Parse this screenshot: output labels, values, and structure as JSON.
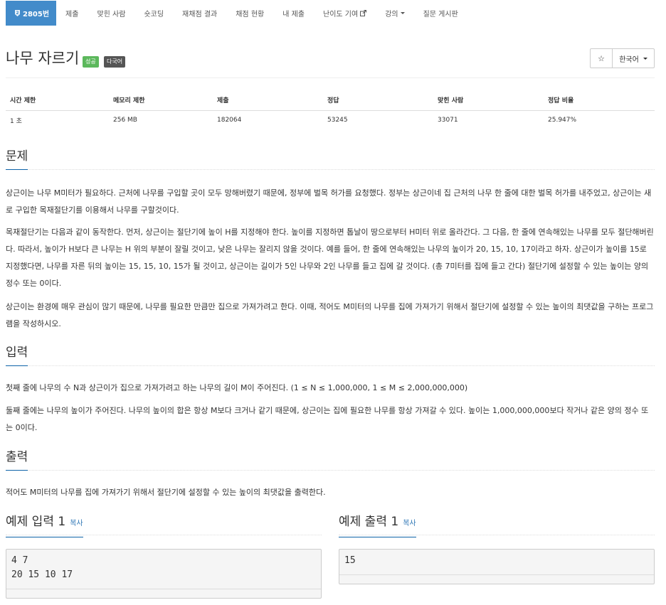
{
  "nav": {
    "tabs": [
      {
        "label": "2805번"
      },
      {
        "label": "제출"
      },
      {
        "label": "맞힌 사람"
      },
      {
        "label": "숏코딩"
      },
      {
        "label": "재채점 결과"
      },
      {
        "label": "채점 현황"
      },
      {
        "label": "내 제출"
      },
      {
        "label": "난이도 기여"
      },
      {
        "label": "강의"
      },
      {
        "label": "질문 게시판"
      }
    ]
  },
  "problem": {
    "title": "나무 자르기",
    "badges": {
      "success": "성공",
      "lang": "다국어"
    },
    "star_icon": "☆",
    "language": "한국어",
    "colors": {
      "primary": "#428bca",
      "success": "#5cb85c",
      "badge_dark": "#555555",
      "link": "#337ab7"
    }
  },
  "info": {
    "headers": [
      "시간 제한",
      "메모리 제한",
      "제출",
      "정답",
      "맞힌 사람",
      "정답 비율"
    ],
    "values": [
      "1 초",
      "256 MB",
      "182064",
      "53245",
      "33071",
      "25.947%"
    ]
  },
  "sections": {
    "description": {
      "heading": "문제",
      "paragraphs": [
        "상근이는 나무 M미터가 필요하다. 근처에 나무를 구입할 곳이 모두 망해버렸기 때문에, 정부에 벌목 허가를 요청했다. 정부는 상근이네 집 근처의 나무 한 줄에 대한 벌목 허가를 내주었고, 상근이는 새로 구입한 목재절단기를 이용해서 나무를 구할것이다.",
        "목재절단기는 다음과 같이 동작한다. 먼저, 상근이는 절단기에 높이 H를 지정해야 한다. 높이를 지정하면 톱날이 땅으로부터 H미터 위로 올라간다. 그 다음, 한 줄에 연속해있는 나무를 모두 절단해버린다. 따라서, 높이가 H보다 큰 나무는 H 위의 부분이 잘릴 것이고, 낮은 나무는 잘리지 않을 것이다. 예를 들어, 한 줄에 연속해있는 나무의 높이가 20, 15, 10, 17이라고 하자. 상근이가 높이를 15로 지정했다면, 나무를 자른 뒤의 높이는 15, 15, 10, 15가 될 것이고, 상근이는 길이가 5인 나무와 2인 나무를 들고 집에 갈 것이다. (총 7미터를 집에 들고 간다) 절단기에 설정할 수 있는 높이는 양의 정수 또는 0이다.",
        "상근이는 환경에 매우 관심이 많기 때문에, 나무를 필요한 만큼만 집으로 가져가려고 한다. 이때, 적어도 M미터의 나무를 집에 가져가기 위해서 절단기에 설정할 수 있는 높이의 최댓값을 구하는 프로그램을 작성하시오."
      ]
    },
    "input": {
      "heading": "입력",
      "paragraphs": [
        "첫째 줄에 나무의 수 N과 상근이가 집으로 가져가려고 하는 나무의 길이 M이 주어진다. (1 ≤ N ≤ 1,000,000, 1 ≤ M ≤ 2,000,000,000)",
        "둘째 줄에는 나무의 높이가 주어진다. 나무의 높이의 합은 항상 M보다 크거나 같기 때문에, 상근이는 집에 필요한 나무를 항상 가져갈 수 있다. 높이는 1,000,000,000보다 작거나 같은 양의 정수 또는 0이다."
      ]
    },
    "output": {
      "heading": "출력",
      "paragraphs": [
        "적어도 M미터의 나무를 집에 가져가기 위해서 절단기에 설정할 수 있는 높이의 최댓값을 출력한다."
      ]
    }
  },
  "samples": {
    "copy_label": "복사",
    "input": {
      "heading": "예제 입력 1",
      "text": "4 7\n20 15 10 17"
    },
    "output": {
      "heading": "예제 출력 1",
      "text": "15"
    }
  }
}
